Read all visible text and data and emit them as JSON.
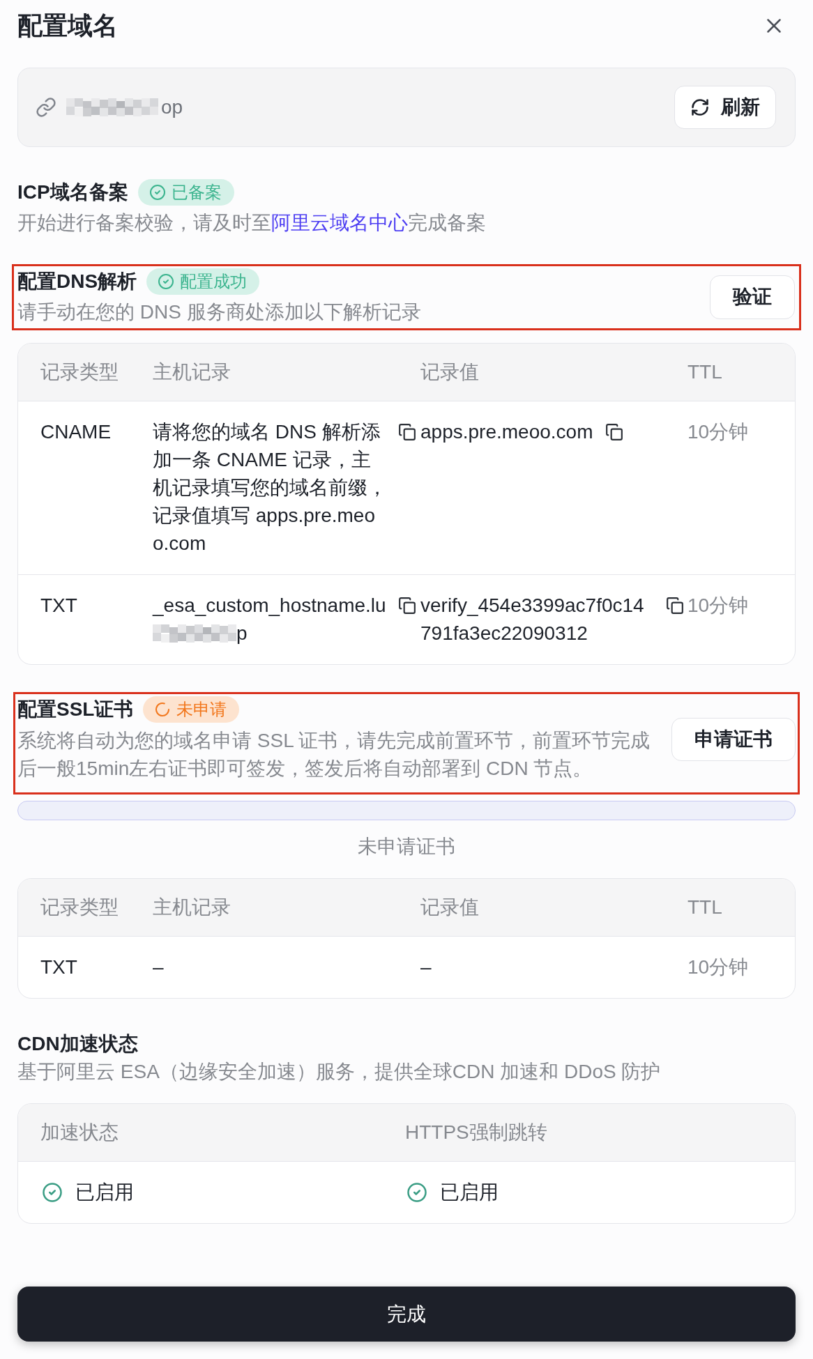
{
  "dialog": {
    "title": "配置域名"
  },
  "domain_bar": {
    "domain_visible": "op",
    "redacted": true,
    "refresh_button": "刷新"
  },
  "icp": {
    "title": "ICP域名备案",
    "badge": {
      "label": "已备案",
      "kind": "success"
    },
    "text_before": "开始进行备案校验，请及时至",
    "link": "阿里云域名中心",
    "text_after": "完成备案"
  },
  "dns": {
    "title": "配置DNS解析",
    "badge": {
      "label": "配置成功",
      "kind": "success"
    },
    "description": "请手动在您的 DNS 服务商处添加以下解析记录",
    "button": "验证",
    "highlighted": true,
    "table": {
      "columns": [
        "记录类型",
        "主机记录",
        "记录值",
        "TTL"
      ],
      "rows": [
        {
          "type": "CNAME",
          "host": "请将您的域名 DNS 解析添加一条 CNAME 记录，主机记录填写您的域名前缀，记录值填写 apps.pre.meoo.com",
          "value": "apps.pre.meoo.com",
          "ttl": "10分钟",
          "copyable": true
        },
        {
          "type": "TXT",
          "host": "_esa_custom_hostname.lu",
          "host_redacted": true,
          "host_tail": "p",
          "value": "verify_454e3399ac7f0c14791fa3ec22090312",
          "ttl": "10分钟",
          "copyable": true
        }
      ]
    }
  },
  "ssl": {
    "title": "配置SSL证书",
    "badge": {
      "label": "未申请",
      "kind": "pending"
    },
    "description": "系统将自动为您的域名申请 SSL 证书，请先完成前置环节，前置环节完成后一般15min左右证书即可签发，签发后将自动部署到 CDN 节点。",
    "button": "申请证书",
    "highlighted": true,
    "status_text": "未申请证书",
    "table": {
      "columns": [
        "记录类型",
        "主机记录",
        "记录值",
        "TTL"
      ],
      "rows": [
        {
          "type": "TXT",
          "host": "–",
          "value": "–",
          "ttl": "10分钟",
          "copyable": false
        }
      ]
    }
  },
  "cdn": {
    "title": "CDN加速状态",
    "description": "基于阿里云 ESA（边缘安全加速）服务，提供全球CDN 加速和 DDoS 防护",
    "table": {
      "columns": [
        "加速状态",
        "HTTPS强制跳转"
      ],
      "rows": [
        {
          "cells": [
            {
              "label": "已启用",
              "enabled": true
            },
            {
              "label": "已启用",
              "enabled": true
            }
          ]
        }
      ]
    }
  },
  "done_button": "完成"
}
